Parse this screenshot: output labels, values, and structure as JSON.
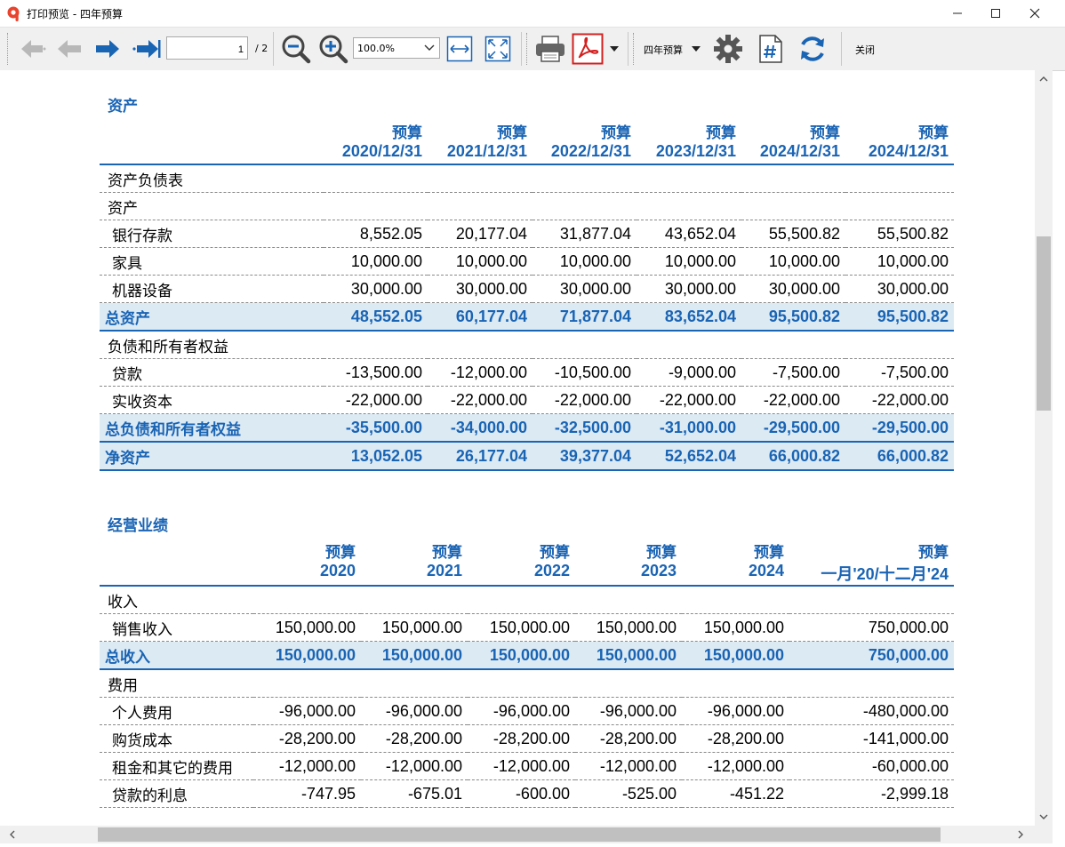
{
  "window": {
    "title": "打印预览 - 四年预算",
    "minimize": "—",
    "maximize": "☐",
    "close": "✕"
  },
  "toolbar": {
    "page_value": "1",
    "page_total": "/ 2",
    "zoom_value": "100.0%",
    "report_select": "四年预算",
    "close_label": "关闭"
  },
  "balance": {
    "title": "资产",
    "header_top": [
      "预算",
      "预算",
      "预算",
      "预算",
      "预算",
      "预算"
    ],
    "header_dates": [
      "2020/12/31",
      "2021/12/31",
      "2022/12/31",
      "2023/12/31",
      "2024/12/31",
      "2024/12/31"
    ],
    "rows": [
      {
        "label": "资产负债表",
        "values": [
          "",
          "",
          "",
          "",
          "",
          ""
        ],
        "type": "group"
      },
      {
        "label": "资产",
        "values": [
          "",
          "",
          "",
          "",
          "",
          ""
        ],
        "type": "group"
      },
      {
        "label": "银行存款",
        "values": [
          "8,552.05",
          "20,177.04",
          "31,877.04",
          "43,652.04",
          "55,500.82",
          "55,500.82"
        ],
        "type": "item"
      },
      {
        "label": "家具",
        "values": [
          "10,000.00",
          "10,000.00",
          "10,000.00",
          "10,000.00",
          "10,000.00",
          "10,000.00"
        ],
        "type": "item"
      },
      {
        "label": "机器设备",
        "values": [
          "30,000.00",
          "30,000.00",
          "30,000.00",
          "30,000.00",
          "30,000.00",
          "30,000.00"
        ],
        "type": "item"
      },
      {
        "label": "总资产",
        "values": [
          "48,552.05",
          "60,177.04",
          "71,877.04",
          "83,652.04",
          "95,500.82",
          "95,500.82"
        ],
        "type": "total"
      },
      {
        "label": "负债和所有者权益",
        "values": [
          "",
          "",
          "",
          "",
          "",
          ""
        ],
        "type": "group"
      },
      {
        "label": "贷款",
        "values": [
          "-13,500.00",
          "-12,000.00",
          "-10,500.00",
          "-9,000.00",
          "-7,500.00",
          "-7,500.00"
        ],
        "type": "item"
      },
      {
        "label": "实收资本",
        "values": [
          "-22,000.00",
          "-22,000.00",
          "-22,000.00",
          "-22,000.00",
          "-22,000.00",
          "-22,000.00"
        ],
        "type": "item"
      },
      {
        "label": "总负债和所有者权益",
        "values": [
          "-35,500.00",
          "-34,000.00",
          "-32,500.00",
          "-31,000.00",
          "-29,500.00",
          "-29,500.00"
        ],
        "type": "total"
      },
      {
        "label": "净资产",
        "values": [
          "13,052.05",
          "26,177.04",
          "39,377.04",
          "52,652.04",
          "66,000.82",
          "66,000.82"
        ],
        "type": "total"
      }
    ]
  },
  "income": {
    "title": "经营业绩",
    "header_top": [
      "预算",
      "预算",
      "预算",
      "预算",
      "预算",
      "预算"
    ],
    "header_years": [
      "2020",
      "2021",
      "2022",
      "2023",
      "2024",
      "一月'20/十二月'24"
    ],
    "rows": [
      {
        "label": "收入",
        "values": [
          "",
          "",
          "",
          "",
          "",
          ""
        ],
        "type": "group"
      },
      {
        "label": "销售收入",
        "values": [
          "150,000.00",
          "150,000.00",
          "150,000.00",
          "150,000.00",
          "150,000.00",
          "750,000.00"
        ],
        "type": "item"
      },
      {
        "label": "总收入",
        "values": [
          "150,000.00",
          "150,000.00",
          "150,000.00",
          "150,000.00",
          "150,000.00",
          "750,000.00"
        ],
        "type": "total"
      },
      {
        "label": "费用",
        "values": [
          "",
          "",
          "",
          "",
          "",
          ""
        ],
        "type": "group"
      },
      {
        "label": "个人费用",
        "values": [
          "-96,000.00",
          "-96,000.00",
          "-96,000.00",
          "-96,000.00",
          "-96,000.00",
          "-480,000.00"
        ],
        "type": "item"
      },
      {
        "label": "购货成本",
        "values": [
          "-28,200.00",
          "-28,200.00",
          "-28,200.00",
          "-28,200.00",
          "-28,200.00",
          "-141,000.00"
        ],
        "type": "item"
      },
      {
        "label": "租金和其它的费用",
        "values": [
          "-12,000.00",
          "-12,000.00",
          "-12,000.00",
          "-12,000.00",
          "-12,000.00",
          "-60,000.00"
        ],
        "type": "item"
      },
      {
        "label": "贷款的利息",
        "values": [
          "-747.95",
          "-675.01",
          "-600.00",
          "-525.00",
          "-451.22",
          "-2,999.18"
        ],
        "type": "item"
      }
    ]
  },
  "colors": {
    "accent": "#1a64b4",
    "total_bg": "#dceaf4",
    "pdf_red": "#d32020"
  },
  "icons": [
    "app-logo-icon",
    "first-page-icon",
    "previous-page-icon",
    "next-page-icon",
    "last-page-icon",
    "zoom-out-icon",
    "zoom-in-icon",
    "fit-width-icon",
    "fit-page-icon",
    "print-icon",
    "pdf-icon",
    "gear-icon",
    "page-number-icon",
    "refresh-icon"
  ]
}
